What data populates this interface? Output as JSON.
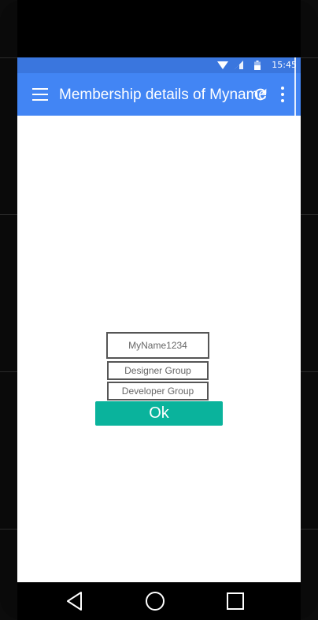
{
  "status_bar": {
    "time": "15:45",
    "wifi_icon": "wifi-icon",
    "signal_icon": "signal-icon",
    "battery_icon": "battery-icon"
  },
  "app_bar": {
    "menu_icon": "hamburger-menu-icon",
    "title": "Membership details of Myname",
    "refresh_icon": "refresh-icon",
    "overflow_icon": "more-vert-icon"
  },
  "form": {
    "name_value": "MyName1234",
    "groups": [
      "Designer Group",
      "Developer Group"
    ],
    "ok_label": "Ok"
  },
  "nav_bar": {
    "back_icon": "back-icon",
    "home_icon": "home-icon",
    "recents_icon": "recents-icon"
  },
  "colors": {
    "app_bar": "#4285f4",
    "status_bar": "#3a76de",
    "ok_button": "#0ab39c"
  }
}
